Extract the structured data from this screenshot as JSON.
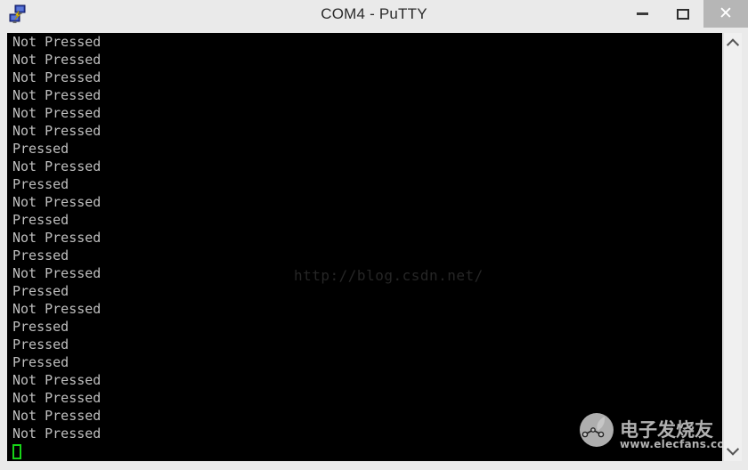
{
  "window": {
    "title": "COM4 - PuTTY",
    "app_icon_name": "putty-network-icon",
    "controls": {
      "minimize_label": "–",
      "maximize_label": "□",
      "close_label": "✕"
    }
  },
  "terminal": {
    "background_color": "#000000",
    "text_color": "#bfbfbf",
    "cursor_color": "#17d417",
    "lines": [
      "Not Pressed",
      "Not Pressed",
      "Not Pressed",
      "Not Pressed",
      "Not Pressed",
      "Not Pressed",
      "Pressed",
      "Not Pressed",
      "Pressed",
      "Not Pressed",
      "Pressed",
      "Not Pressed",
      "Pressed",
      "Not Pressed",
      "Pressed",
      "Not Pressed",
      "Pressed",
      "Pressed",
      "Pressed",
      "Not Pressed",
      "Not Pressed",
      "Not Pressed",
      "Not Pressed"
    ]
  },
  "watermarks": {
    "url": "http://blog.csdn.net/",
    "logo_cn": "电子发烧友",
    "logo_url": "www.elecfans.com"
  },
  "scrollbar": {
    "up_arrow_name": "scroll-up-arrow",
    "down_arrow_name": "scroll-down-arrow"
  }
}
